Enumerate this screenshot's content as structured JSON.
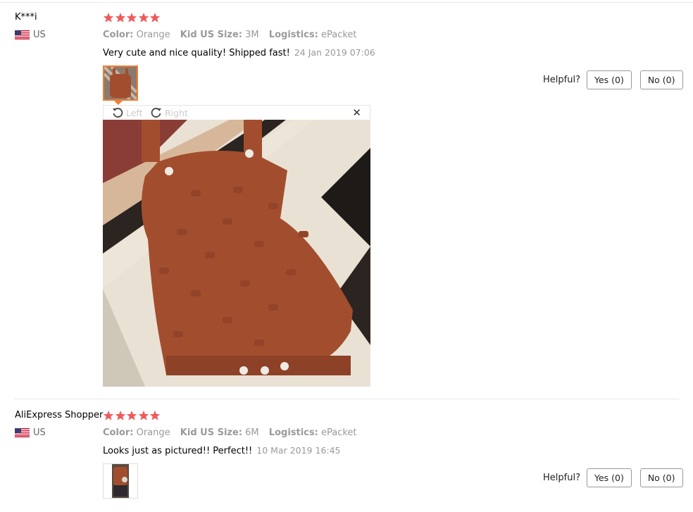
{
  "reviews": [
    {
      "user": "K***i",
      "country": "US",
      "rating": 5,
      "attributes": [
        {
          "key": "Color:",
          "value": "Orange"
        },
        {
          "key": "Kid US Size:",
          "value": "3M"
        },
        {
          "key": "Logistics:",
          "value": "ePacket"
        }
      ],
      "comment": "Very cute and nice quality! Shipped fast!",
      "date": "24 Jan 2019 07:06",
      "helpful_label": "Helpful?",
      "yes_label": "Yes (0)",
      "no_label": "No (0)"
    },
    {
      "user": "AliExpress Shopper",
      "country": "US",
      "rating": 5,
      "attributes": [
        {
          "key": "Color:",
          "value": "Orange"
        },
        {
          "key": "Kid US Size:",
          "value": "6M"
        },
        {
          "key": "Logistics:",
          "value": "ePacket"
        }
      ],
      "comment": "Looks just as pictured!! Perfect!!",
      "date": "10 Mar 2019 16:45",
      "helpful_label": "Helpful?",
      "yes_label": "Yes (0)",
      "no_label": "No (0)"
    }
  ],
  "viewer": {
    "rotate_left": "Left",
    "rotate_right": "Right",
    "close": "✕"
  },
  "colors": {
    "star": "#f05a5a",
    "accent": "#f17d30",
    "product": "#a24e2e"
  }
}
